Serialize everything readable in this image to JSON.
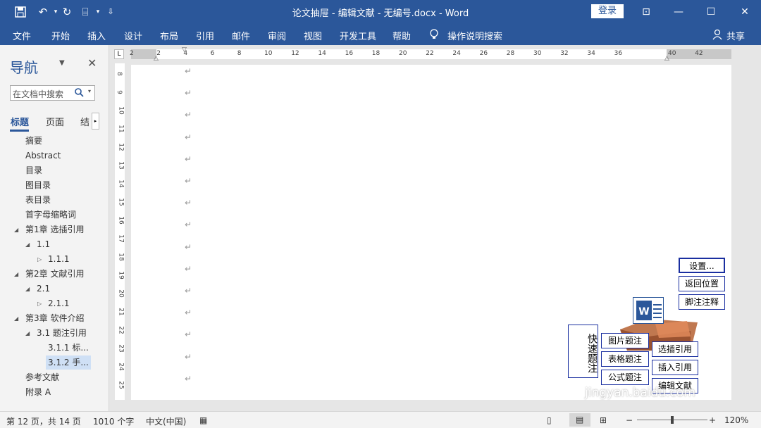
{
  "titlebar": {
    "title": "论文抽屉 - 编辑文献 - 无编号.docx  -  Word",
    "login": "登录",
    "qa_save_icon": "save-icon",
    "qa_undo_icon": "undo-icon",
    "qa_redo_icon": "redo-icon",
    "qa_table_icon": "table-icon",
    "qa_customize_icon": "customize-icon"
  },
  "ribbon": {
    "tabs": [
      "文件",
      "开始",
      "插入",
      "设计",
      "布局",
      "引用",
      "邮件",
      "审阅",
      "视图",
      "开发工具",
      "帮助"
    ],
    "tell_me": "操作说明搜索",
    "share": "共享"
  },
  "nav": {
    "title": "导航",
    "search_placeholder": "在文档中搜索",
    "tabs": [
      "标题",
      "页面",
      "结"
    ],
    "items": [
      {
        "label": "摘要"
      },
      {
        "label": "Abstract"
      },
      {
        "label": "目录"
      },
      {
        "label": "图目录"
      },
      {
        "label": "表目录"
      },
      {
        "label": "首字母缩略词"
      },
      {
        "label": "第1章 选插引用"
      },
      {
        "label": "1.1"
      },
      {
        "label": "1.1.1"
      },
      {
        "label": "第2章 文献引用"
      },
      {
        "label": "2.1"
      },
      {
        "label": "2.1.1"
      },
      {
        "label": "第3章 软件介绍"
      },
      {
        "label": "3.1 题注引用"
      },
      {
        "label": "3.1.1 标..."
      },
      {
        "label": "3.1.2 手..."
      },
      {
        "label": "参考文献"
      },
      {
        "label": "附录 A"
      }
    ]
  },
  "ruler": {
    "h_labels": [
      "2",
      "2",
      "4",
      "6",
      "8",
      "10",
      "12",
      "14",
      "16",
      "18",
      "20",
      "22",
      "24",
      "26",
      "28",
      "30",
      "32",
      "34",
      "36",
      "",
      "40",
      "42"
    ],
    "v_labels": [
      "8",
      "9",
      "10",
      "11",
      "12",
      "13",
      "14",
      "15",
      "16",
      "17",
      "18",
      "19",
      "20",
      "21",
      "22",
      "23",
      "24",
      "25"
    ]
  },
  "doc": {
    "para_mark": "↵"
  },
  "tools": {
    "right_buttons": [
      "设置...",
      "返回位置",
      "脚注注释"
    ],
    "quick_caption": "快速题注",
    "left_buttons": [
      "图片题注",
      "表格题注",
      "公式题注"
    ],
    "mid_buttons": [
      "选插引用",
      "插入引用",
      "编辑文献"
    ]
  },
  "status": {
    "page": "第 12 页，共 14 页",
    "words": "1010 个字",
    "lang": "中文(中国)",
    "zoom": "120%"
  },
  "watermark": "jingyan.baidu.com"
}
